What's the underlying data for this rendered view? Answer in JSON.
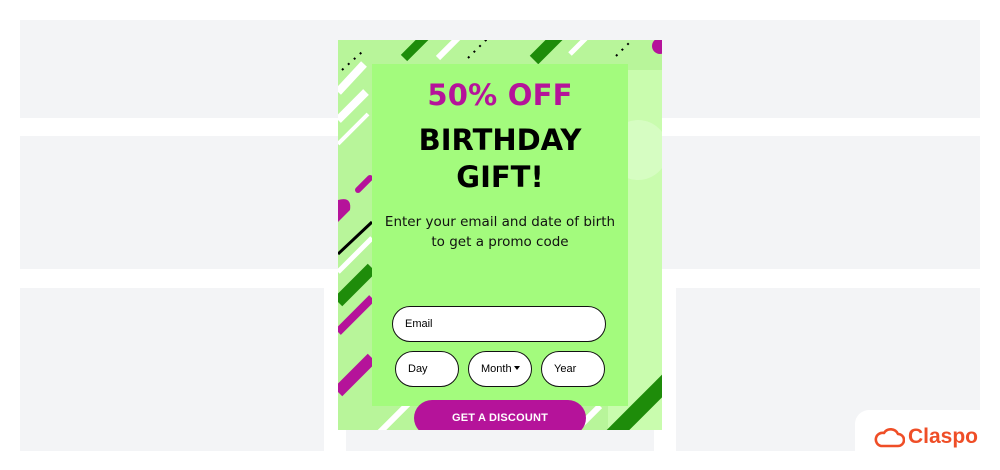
{
  "popup": {
    "headline_discount": "50% OFF",
    "headline_line1": "BIRTHDAY",
    "headline_line2": "GIFT!",
    "subtitle_line1": "Enter your email and date of birth",
    "subtitle_line2": "to get a promo code",
    "email_placeholder": "Email",
    "day_placeholder": "Day",
    "month_placeholder": "Month",
    "year_placeholder": "Year",
    "cta_label": "GET A DISCOUNT"
  },
  "brand": {
    "name": "Claspo"
  },
  "colors": {
    "accent": "#b5139a",
    "popup_background": "#b8f59a",
    "panel_background": "#a3fb7d",
    "deco_dark_green": "#1e8c0a",
    "brand": "#ef4e27"
  }
}
